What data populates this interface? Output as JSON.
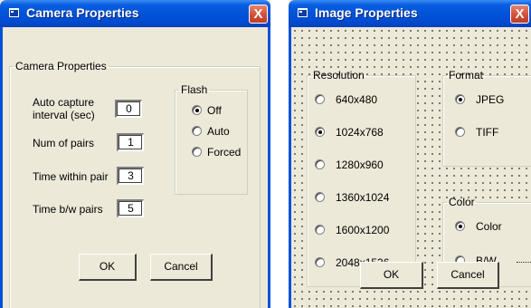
{
  "camera": {
    "title": "Camera Properties",
    "close": "X",
    "group_label": "Camera Properties",
    "fields": [
      {
        "label": "Auto capture\ninterval (sec)",
        "value": "0"
      },
      {
        "label": "Num of pairs",
        "value": "1"
      },
      {
        "label": "Time within pair",
        "value": "3"
      },
      {
        "label": "Time b/w pairs",
        "value": "5"
      }
    ],
    "flash": {
      "label": "Flash",
      "options": [
        {
          "label": "Off",
          "checked": true
        },
        {
          "label": "Auto",
          "checked": false
        },
        {
          "label": "Forced",
          "checked": false
        }
      ]
    },
    "ok": "OK",
    "cancel": "Cancel"
  },
  "image": {
    "title": "Image Properties",
    "close": "X",
    "resolution": {
      "label": "Resolution",
      "options": [
        {
          "label": "640x480",
          "checked": false
        },
        {
          "label": "1024x768",
          "checked": true
        },
        {
          "label": "1280x960",
          "checked": false
        },
        {
          "label": "1360x1024",
          "checked": false
        },
        {
          "label": "1600x1200",
          "checked": false
        },
        {
          "label": "2048x1536",
          "checked": false
        }
      ]
    },
    "format": {
      "label": "Format",
      "options": [
        {
          "label": "JPEG",
          "checked": true
        },
        {
          "label": "TIFF",
          "checked": false
        }
      ]
    },
    "color": {
      "label": "Color",
      "options": [
        {
          "label": "Color",
          "checked": true
        },
        {
          "label": "B/W",
          "checked": false
        }
      ]
    },
    "ok": "OK",
    "cancel": "Cancel"
  },
  "colors": {
    "title_blue": "#0053d8",
    "dialog_bg": "#ece9d8",
    "close_red": "#d0503a"
  },
  "icons": [
    "app-icon",
    "close-icon"
  ]
}
